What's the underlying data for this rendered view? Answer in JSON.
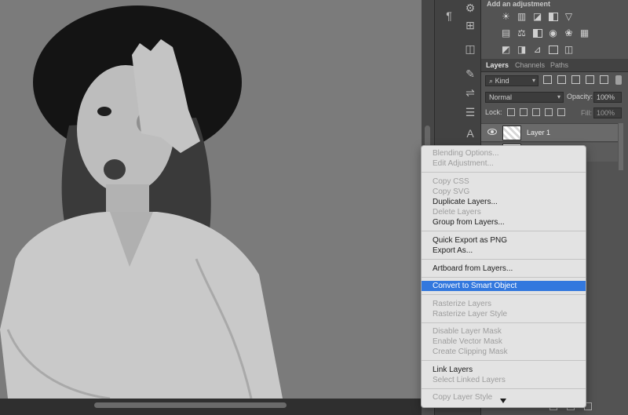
{
  "adjustments_panel": {
    "title": "Add an adjustment"
  },
  "layers_panel": {
    "tabs": [
      "Layers",
      "Channels",
      "Paths"
    ],
    "filter_kind": "Kind",
    "blend_mode": "Normal",
    "opacity_label": "Opacity:",
    "opacity_value": "100%",
    "lock_label": "Lock:",
    "fill_label": "Fill:",
    "fill_value": "100%",
    "layers": [
      {
        "name": "Layer 1",
        "visible": true,
        "selected": true
      }
    ]
  },
  "context_menu": {
    "items": [
      {
        "label": "Blending Options...",
        "enabled": false
      },
      {
        "label": "Edit Adjustment...",
        "enabled": false
      },
      {
        "label": "Copy CSS",
        "enabled": false
      },
      {
        "label": "Copy SVG",
        "enabled": false
      },
      {
        "label": "Duplicate Layers...",
        "enabled": true
      },
      {
        "label": "Delete Layers",
        "enabled": false
      },
      {
        "label": "Group from Layers...",
        "enabled": true
      },
      {
        "label": "Quick Export as PNG",
        "enabled": true
      },
      {
        "label": "Export As...",
        "enabled": true
      },
      {
        "label": "Artboard from Layers...",
        "enabled": true
      },
      {
        "label": "Convert to Smart Object",
        "enabled": true,
        "highlighted": true
      },
      {
        "label": "Rasterize Layers",
        "enabled": false
      },
      {
        "label": "Rasterize Layer Style",
        "enabled": false
      },
      {
        "label": "Disable Layer Mask",
        "enabled": false
      },
      {
        "label": "Enable Vector Mask",
        "enabled": false
      },
      {
        "label": "Create Clipping Mask",
        "enabled": false
      },
      {
        "label": "Link Layers",
        "enabled": true
      },
      {
        "label": "Select Linked Layers",
        "enabled": false
      },
      {
        "label": "Copy Layer Style",
        "enabled": false
      }
    ],
    "highlight_color": "#3378de"
  },
  "colors": {
    "panel_bg": "#535353",
    "toolstrip_bg": "#424242",
    "menu_bg": "#e3e3e3"
  }
}
